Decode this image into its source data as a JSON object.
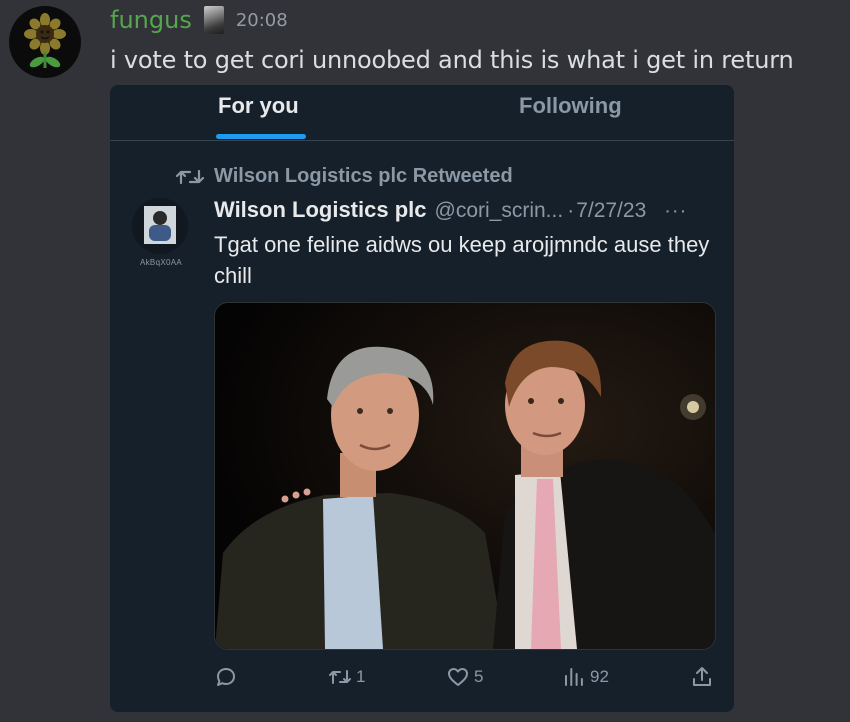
{
  "message": {
    "username": "fungus",
    "timestamp": "20:08",
    "text": "i vote to get cori unnoobed and this is what i get in return"
  },
  "tweet_screenshot": {
    "tabs": [
      {
        "label": "For you",
        "active": true
      },
      {
        "label": "Following",
        "active": false
      }
    ],
    "retweet_label": "Wilson Logistics plc Retweeted",
    "avatar_caption": "AkBqX0AA",
    "author_name": "Wilson Logistics plc",
    "handle": "@cori_scrin...",
    "separator": "·",
    "date": "7/27/23",
    "more": "···",
    "text": "Tgat one feline aidws ou keep arojjmndc ause they chill",
    "actions": {
      "reply_icon": "reply-icon",
      "retweet_icon": "retweet-icon",
      "retweet_count": "1",
      "like_icon": "heart-icon",
      "like_count": "5",
      "views_icon": "views-icon",
      "views_count": "92",
      "share_icon": "share-icon"
    }
  },
  "colors": {
    "discord_bg": "#313338",
    "username": "#56a64e",
    "twitter_bg": "#15202b",
    "accent": "#1d9bf0",
    "muted": "#8b98a5"
  }
}
